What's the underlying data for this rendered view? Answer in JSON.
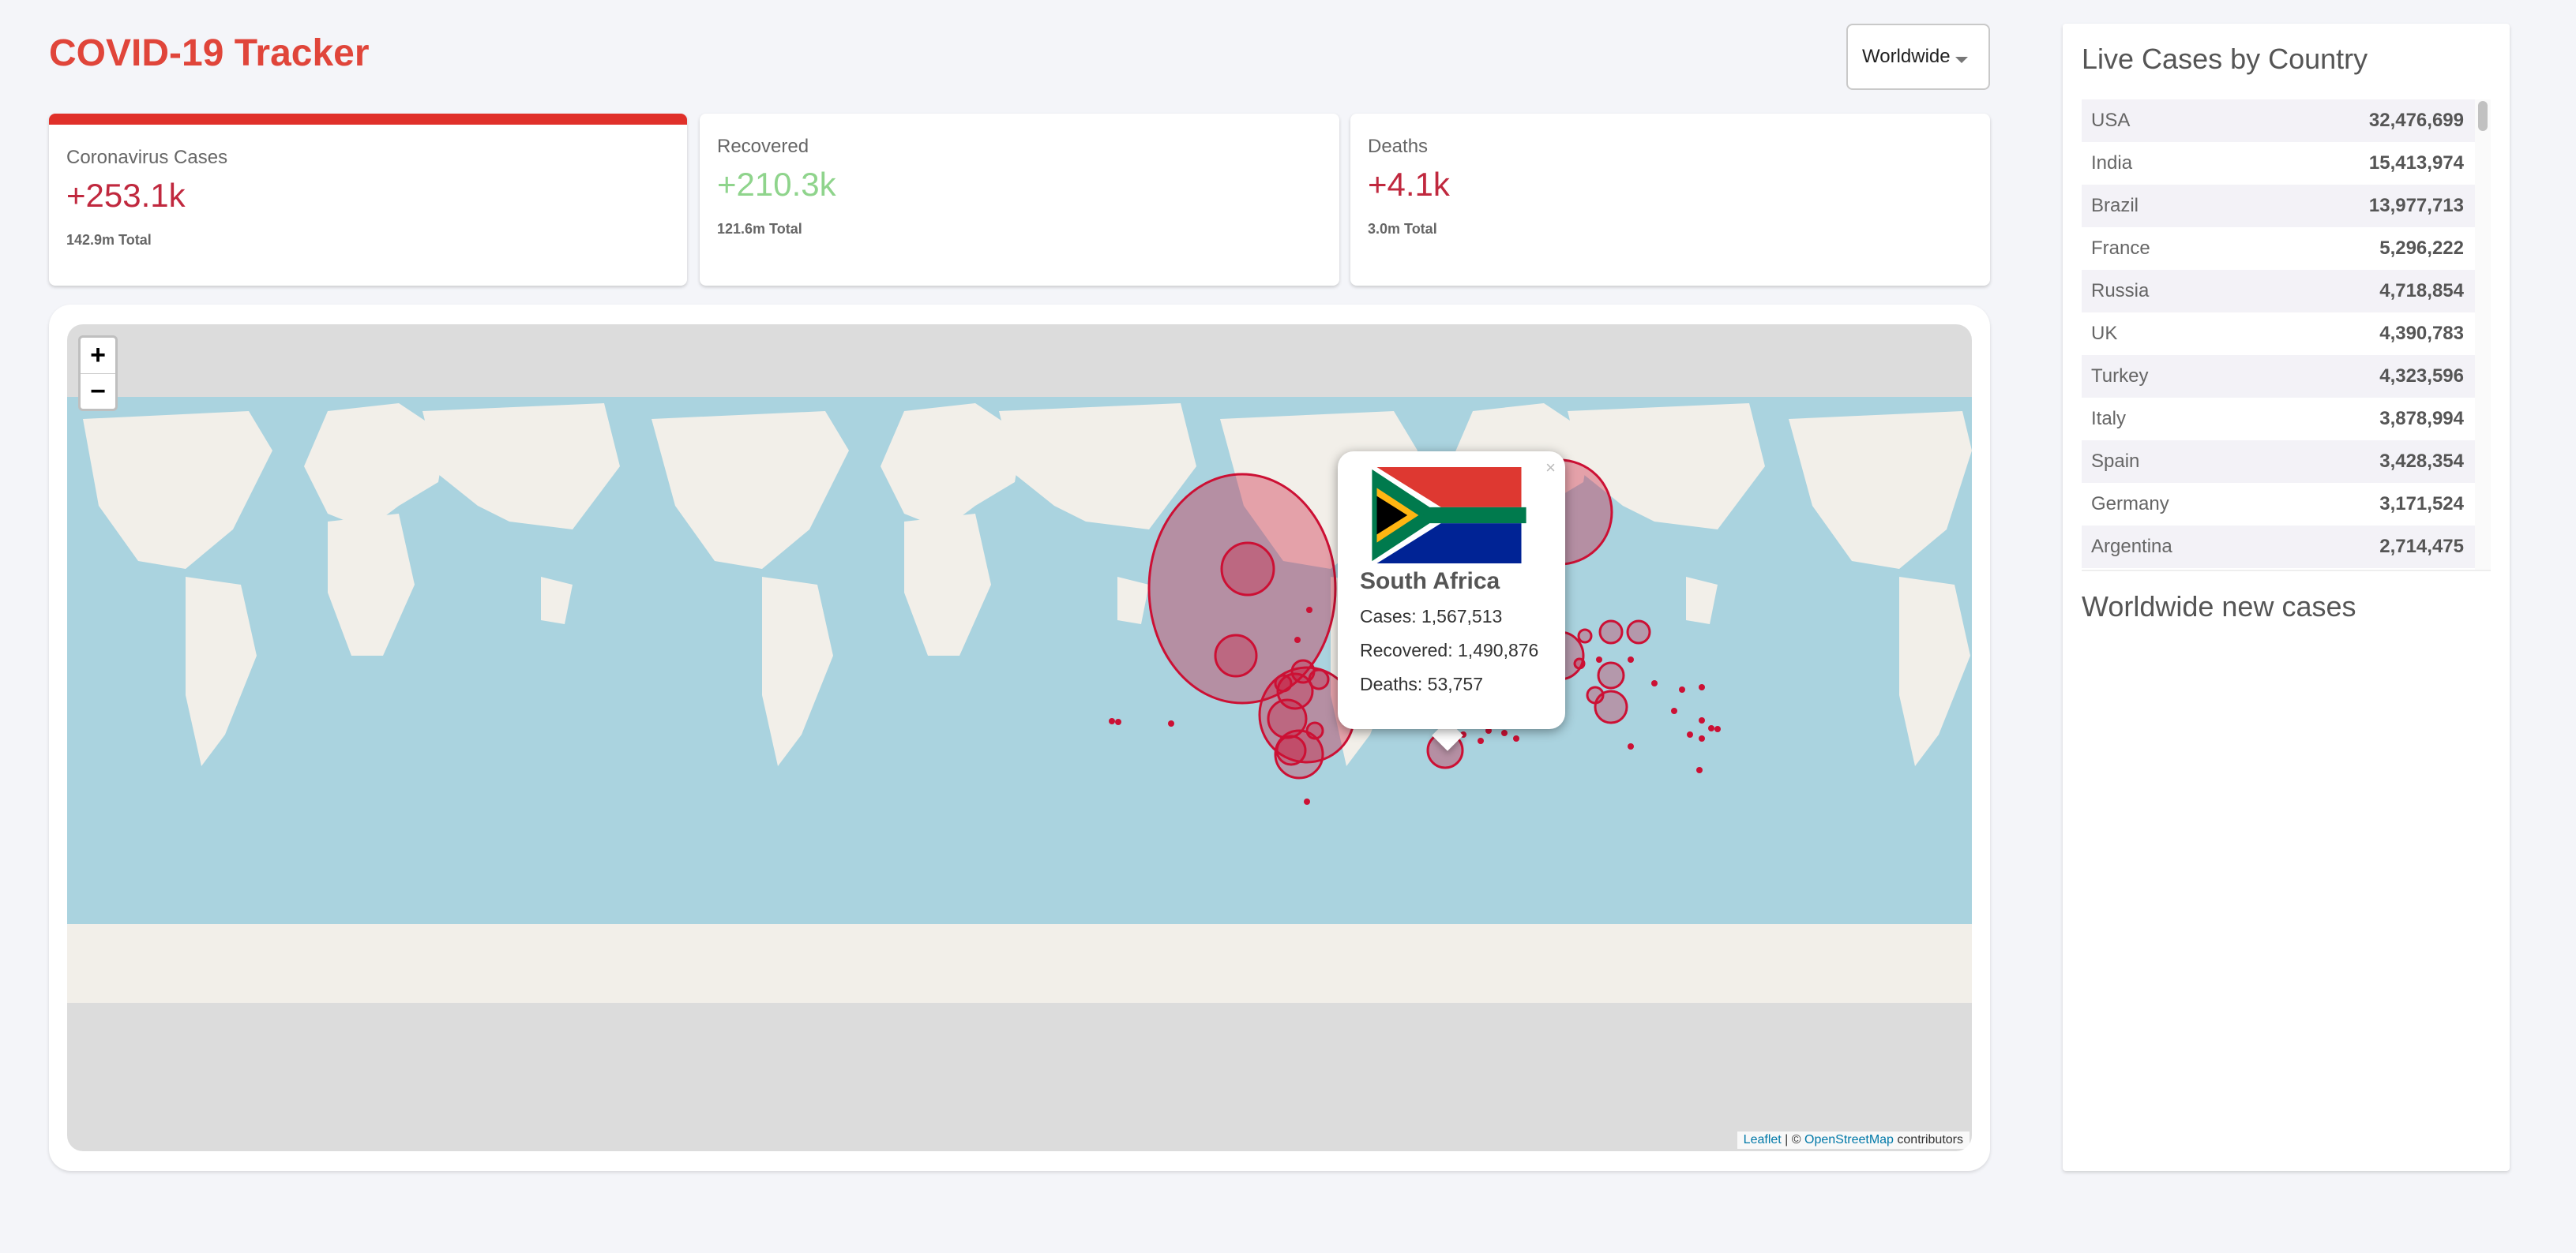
{
  "header": {
    "title": "COVID-19 Tracker",
    "country_select": "Worldwide"
  },
  "stats": [
    {
      "label": "Coronavirus Cases",
      "value": "+253.1k",
      "total": "142.9m Total"
    },
    {
      "label": "Recovered",
      "value": "+210.3k",
      "total": "121.6m Total"
    },
    {
      "label": "Deaths",
      "value": "+4.1k",
      "total": "3.0m Total"
    }
  ],
  "map": {
    "zoom_in": "+",
    "zoom_out": "−",
    "attribution": {
      "leaflet": "Leaflet",
      "sep": " | © ",
      "osm": "OpenStreetMap",
      "rest": " contributors"
    },
    "popup": {
      "close": "×",
      "country": "South Africa",
      "cases": "Cases: 1,567,513",
      "recovered": "Recovered: 1,490,876",
      "deaths": "Deaths: 53,757"
    },
    "colors": {
      "ocean": "#aad3df",
      "land": "#f2efe9",
      "circle": "#cc1034"
    }
  },
  "sidebar": {
    "title": "Live Cases by Country",
    "rows": [
      {
        "country": "USA",
        "cases": "32,476,699"
      },
      {
        "country": "India",
        "cases": "15,413,974"
      },
      {
        "country": "Brazil",
        "cases": "13,977,713"
      },
      {
        "country": "France",
        "cases": "5,296,222"
      },
      {
        "country": "Russia",
        "cases": "4,718,854"
      },
      {
        "country": "UK",
        "cases": "4,390,783"
      },
      {
        "country": "Turkey",
        "cases": "4,323,596"
      },
      {
        "country": "Italy",
        "cases": "3,878,994"
      },
      {
        "country": "Spain",
        "cases": "3,428,354"
      },
      {
        "country": "Germany",
        "cases": "3,171,524"
      },
      {
        "country": "Argentina",
        "cases": "2,714,475"
      }
    ],
    "graph_title": "Worldwide new cases"
  }
}
